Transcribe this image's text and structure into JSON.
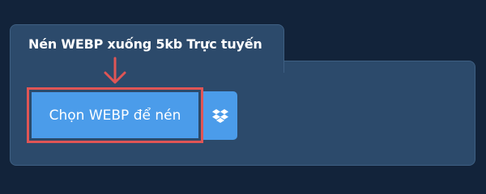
{
  "tab": {
    "title": "Nén WEBP xuống 5kb Trực tuyến"
  },
  "upload": {
    "choose_label": "Chọn WEBP để nén",
    "dropbox_icon": "dropbox-icon",
    "arrow_icon": "arrow-down-icon"
  },
  "colors": {
    "background": "#12233a",
    "panel": "#2c4a6b",
    "button": "#4b9cea",
    "highlight": "#e05555"
  }
}
